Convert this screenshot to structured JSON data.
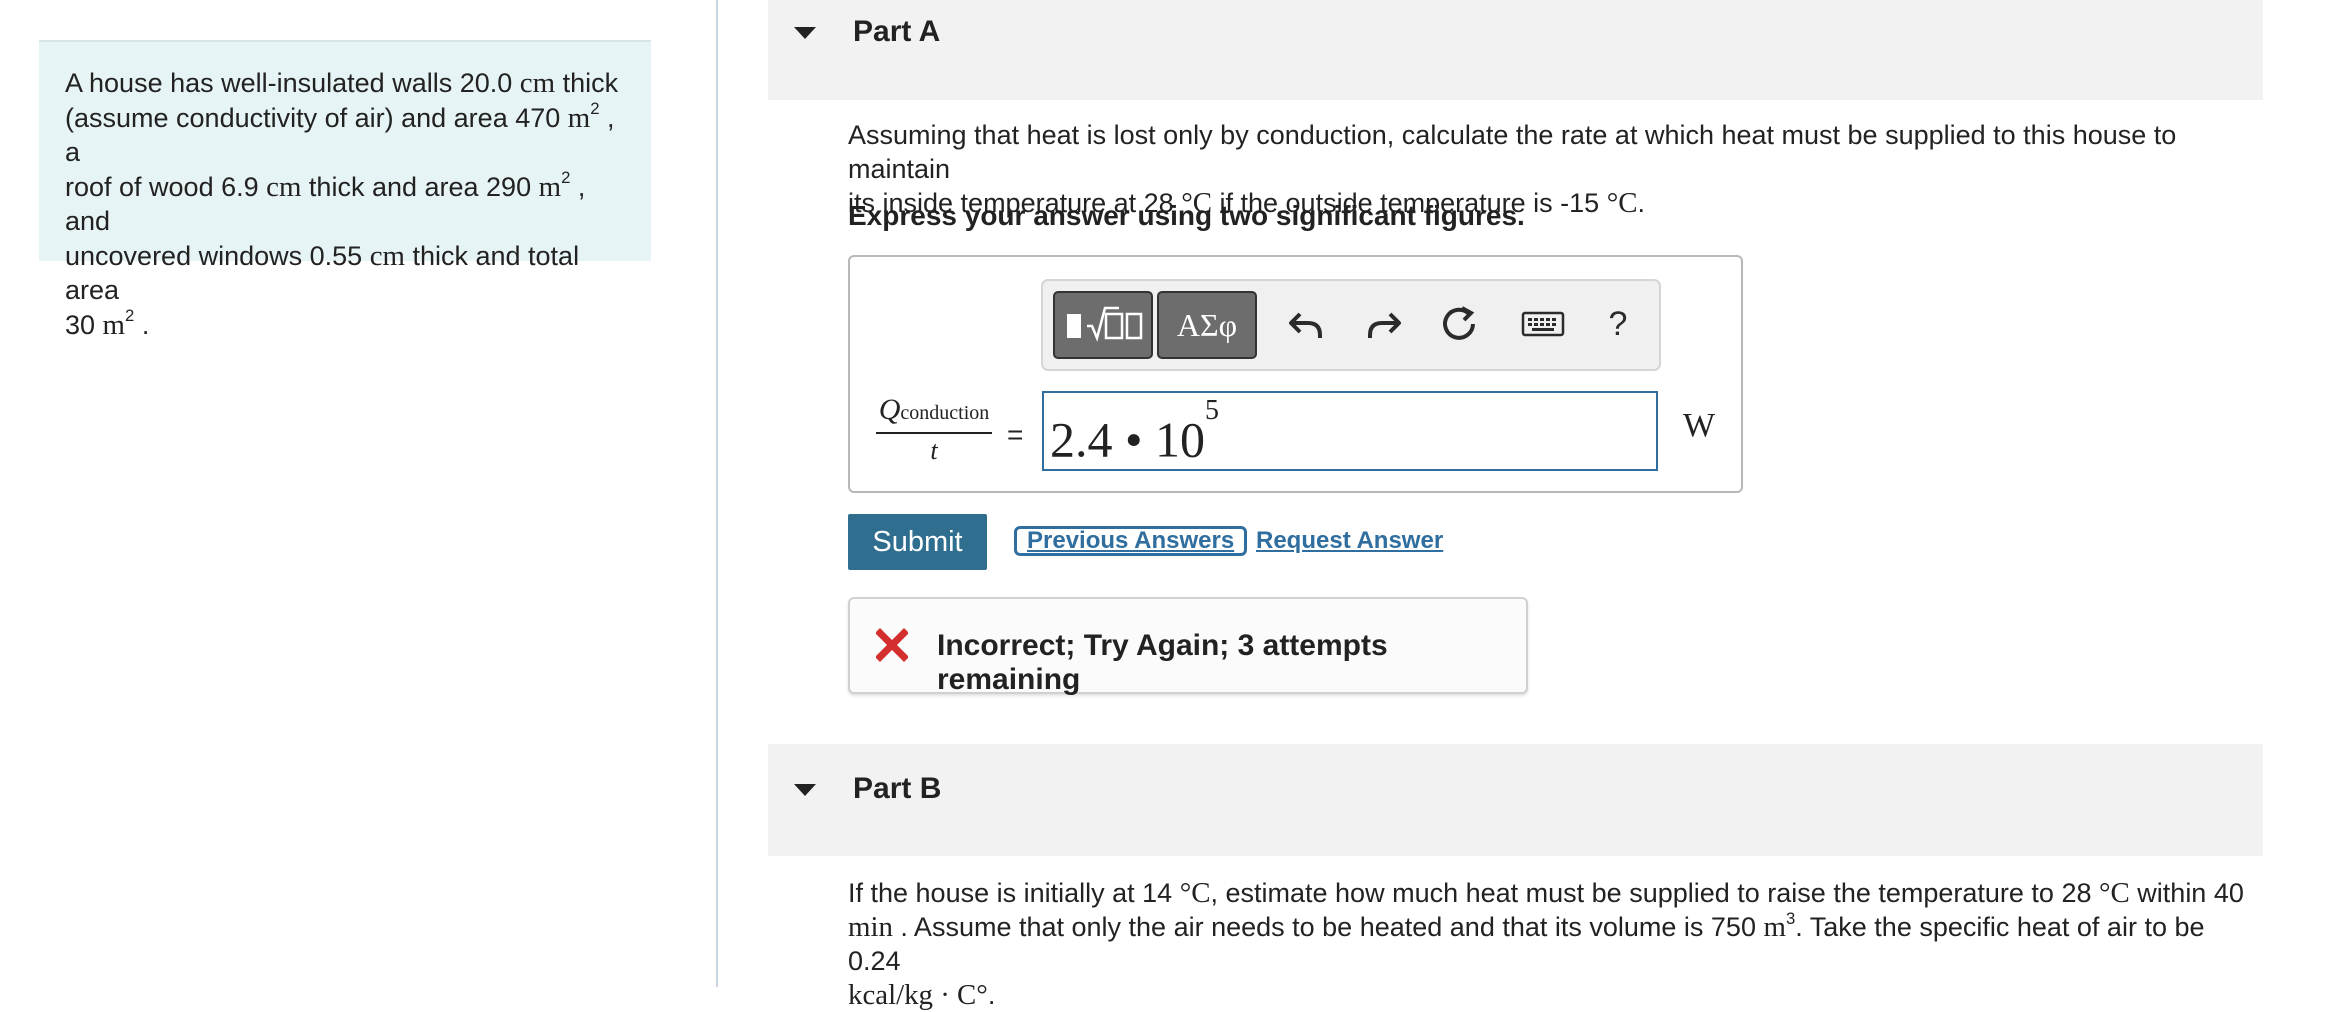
{
  "problem": {
    "line1_pre": "A house has well-insulated walls 20.0 ",
    "line1_unit": "cm",
    "line1_post": " thick",
    "line2_pre": "(assume conductivity of air) and area 470 ",
    "line2_unit": "m",
    "line2_exp": "2",
    "line2_post": " , a",
    "line3_pre": "roof of wood 6.9 ",
    "line3_unit": "cm",
    "line3_mid": " thick and area 290 ",
    "line3_unit2": "m",
    "line3_exp": "2",
    "line3_post": " , and",
    "line4_pre": "uncovered windows 0.55 ",
    "line4_unit": "cm",
    "line4_post": " thick and total area",
    "line5_pre": "30 ",
    "line5_unit": "m",
    "line5_exp": "2",
    "line5_post": " ."
  },
  "part_a": {
    "title": "Part A",
    "question_line1": "Assuming that heat is lost only by conduction, calculate the rate at which heat must be supplied to this house to maintain",
    "question_line2_pre": "its inside temperature at 28 ",
    "question_line2_deg": "°C",
    "question_line2_mid": " if the outside temperature is -15 ",
    "question_line2_deg2": "°C",
    "question_line2_post": ".",
    "instruction": "Express your answer using two significant figures.",
    "toolbar": {
      "templates_label": "▮√▢",
      "symbols_label": "ΑΣφ",
      "help_label": "?"
    },
    "fraction": {
      "numerator": "Q",
      "numerator_sub": "conduction",
      "denominator": "t"
    },
    "equals": "=",
    "answer_mantissa": "2.4 • 10",
    "answer_exponent": "5",
    "answer_unit": "W",
    "submit_label": "Submit",
    "previous_answers_label": "Previous Answers",
    "request_answer_label": "Request Answer",
    "feedback": "Incorrect; Try Again; 3 attempts remaining"
  },
  "part_b": {
    "title": "Part B",
    "q_line1_pre": "If the house is initially at 14 ",
    "q_line1_deg": "°C",
    "q_line1_mid": ", estimate how much heat must be supplied to raise the temperature to 28 ",
    "q_line1_deg2": "°C",
    "q_line1_post": " within 40",
    "q_line2_unit": "min",
    "q_line2_mid": " . Assume that only the air needs to be heated and that its volume is 750 ",
    "q_line2_unit2": "m",
    "q_line2_exp": "3",
    "q_line2_post": ". Take the specific heat of air to be 0.24",
    "q_line3_unit": "kcal/kg · C°",
    "q_line3_post": "."
  },
  "colors": {
    "problem_bg": "#e7f4f5",
    "accent_blue": "#2f6e9e",
    "submit_bg": "#2f6e8f",
    "error_red": "#d32f2f",
    "part_header_bg": "#f2f2f2"
  }
}
